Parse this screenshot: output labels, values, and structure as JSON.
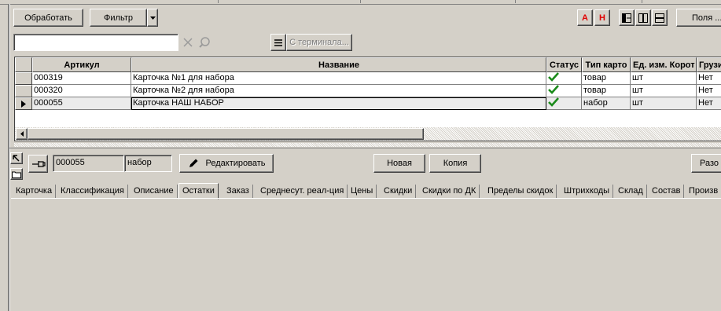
{
  "toolbar": {
    "process_label": "Обработать",
    "filter_label": "Фильтр",
    "font_a_label": "А",
    "font_n_label": "Н",
    "fields_label": "Поля ...",
    "terminal_label": "С терминала...",
    "search_value": ""
  },
  "grid": {
    "columns": [
      "Артикул",
      "Название",
      "Статус",
      "Тип карто",
      "Ед. изм. Корот",
      "Грузи"
    ],
    "rows": [
      {
        "article": "000319",
        "name": "Карточка №1 для набора",
        "type": "товар",
        "unit": "шт",
        "cargo": "Нет"
      },
      {
        "article": "000320",
        "name": "Карточка №2 для набора",
        "type": "товар",
        "unit": "шт",
        "cargo": "Нет"
      },
      {
        "article": "000055",
        "name": "Карточка НАШ НАБОР",
        "type": "набор",
        "unit": "шт",
        "cargo": "Нет"
      }
    ],
    "selected_index": 2
  },
  "detail": {
    "code_value": "000055",
    "type_value": "набор",
    "edit_label": "Редактировать",
    "new_label": "Новая",
    "copy_label": "Копия",
    "right_label": "Разо"
  },
  "tabs": [
    "Карточка",
    "Классификация",
    "Описание",
    "Остатки",
    "Заказ",
    "Среднесут. реал-ция",
    "Цены",
    "Скидки",
    "Скидки по ДК",
    "Пределы скидок",
    "Штрихкоды",
    "Склад",
    "Состав",
    "Произв"
  ],
  "active_tab": 3,
  "colors": {
    "accent_red": "#e00000",
    "check_green": "#1a8a1a"
  }
}
